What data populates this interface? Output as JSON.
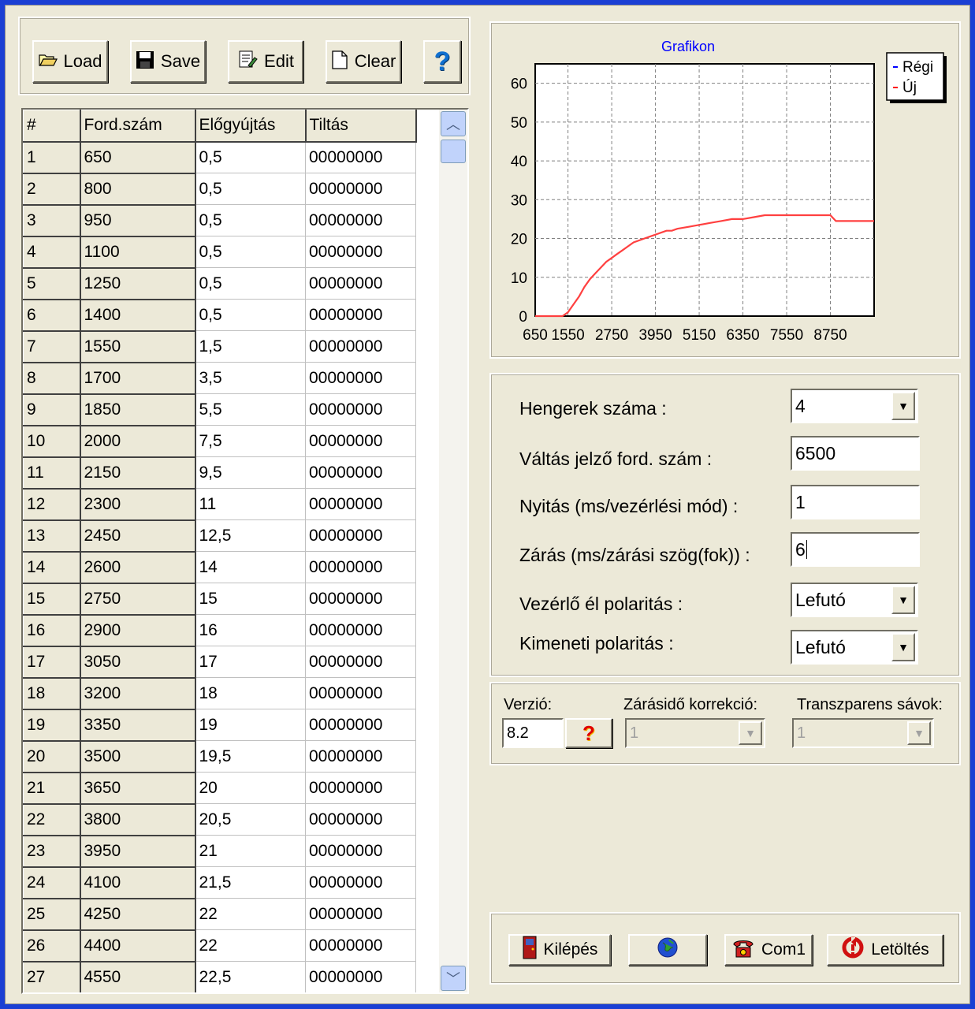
{
  "toolbar": {
    "load": "Load",
    "save": "Save",
    "edit": "Edit",
    "clear": "Clear",
    "help": "?"
  },
  "grid": {
    "headers": [
      "#",
      "Ford.szám",
      "Előgyújtás",
      "Tiltás"
    ],
    "rows": [
      [
        "1",
        "650",
        "0,5",
        "00000000"
      ],
      [
        "2",
        "800",
        "0,5",
        "00000000"
      ],
      [
        "3",
        "950",
        "0,5",
        "00000000"
      ],
      [
        "4",
        "1100",
        "0,5",
        "00000000"
      ],
      [
        "5",
        "1250",
        "0,5",
        "00000000"
      ],
      [
        "6",
        "1400",
        "0,5",
        "00000000"
      ],
      [
        "7",
        "1550",
        "1,5",
        "00000000"
      ],
      [
        "8",
        "1700",
        "3,5",
        "00000000"
      ],
      [
        "9",
        "1850",
        "5,5",
        "00000000"
      ],
      [
        "10",
        "2000",
        "7,5",
        "00000000"
      ],
      [
        "11",
        "2150",
        "9,5",
        "00000000"
      ],
      [
        "12",
        "2300",
        "11",
        "00000000"
      ],
      [
        "13",
        "2450",
        "12,5",
        "00000000"
      ],
      [
        "14",
        "2600",
        "14",
        "00000000"
      ],
      [
        "15",
        "2750",
        "15",
        "00000000"
      ],
      [
        "16",
        "2900",
        "16",
        "00000000"
      ],
      [
        "17",
        "3050",
        "17",
        "00000000"
      ],
      [
        "18",
        "3200",
        "18",
        "00000000"
      ],
      [
        "19",
        "3350",
        "19",
        "00000000"
      ],
      [
        "20",
        "3500",
        "19,5",
        "00000000"
      ],
      [
        "21",
        "3650",
        "20",
        "00000000"
      ],
      [
        "22",
        "3800",
        "20,5",
        "00000000"
      ],
      [
        "23",
        "3950",
        "21",
        "00000000"
      ],
      [
        "24",
        "4100",
        "21,5",
        "00000000"
      ],
      [
        "25",
        "4250",
        "22",
        "00000000"
      ],
      [
        "26",
        "4400",
        "22",
        "00000000"
      ],
      [
        "27",
        "4550",
        "22,5",
        "00000000"
      ]
    ]
  },
  "chart_data": {
    "type": "line",
    "title": "Grafikon",
    "x_tick_labels": [
      "650",
      "1550",
      "2750",
      "3950",
      "5150",
      "6350",
      "7550",
      "8750"
    ],
    "y_tick_labels": [
      "0",
      "10",
      "20",
      "30",
      "40",
      "50",
      "60"
    ],
    "ylim": [
      0,
      65
    ],
    "xlim": [
      650,
      9950
    ],
    "grid": true,
    "legend_position": "top-right",
    "legend": [
      {
        "label": "Régi",
        "color": "#0000ff"
      },
      {
        "label": "Új",
        "color": "#ff0000"
      }
    ],
    "series": [
      {
        "name": "Új",
        "color": "#ff4040",
        "points": [
          [
            650,
            0
          ],
          [
            1400,
            0
          ],
          [
            1550,
            1
          ],
          [
            1700,
            3
          ],
          [
            1850,
            5
          ],
          [
            2000,
            7.5
          ],
          [
            2150,
            9.5
          ],
          [
            2300,
            11
          ],
          [
            2450,
            12.5
          ],
          [
            2600,
            14
          ],
          [
            2750,
            15
          ],
          [
            2900,
            16
          ],
          [
            3050,
            17
          ],
          [
            3200,
            18
          ],
          [
            3350,
            19
          ],
          [
            3500,
            19.5
          ],
          [
            3650,
            20
          ],
          [
            3800,
            20.5
          ],
          [
            3950,
            21
          ],
          [
            4100,
            21.5
          ],
          [
            4250,
            22
          ],
          [
            4400,
            22
          ],
          [
            4550,
            22.5
          ],
          [
            4850,
            23
          ],
          [
            5150,
            23.5
          ],
          [
            5450,
            24
          ],
          [
            5750,
            24.5
          ],
          [
            6050,
            25
          ],
          [
            6350,
            25
          ],
          [
            6650,
            25.5
          ],
          [
            6950,
            26
          ],
          [
            7250,
            26
          ],
          [
            7550,
            26
          ],
          [
            7850,
            26
          ],
          [
            8150,
            26
          ],
          [
            8750,
            26
          ],
          [
            8900,
            24.5
          ],
          [
            9950,
            24.5
          ]
        ]
      }
    ]
  },
  "settings": {
    "cylinders_label": "Hengerek száma :",
    "cylinders_value": "4",
    "shift_rpm_label": "Váltás jelző ford. szám :",
    "shift_rpm_value": "6500",
    "opening_label": "Nyitás (ms/vezérlési mód) :",
    "opening_value": "1",
    "closing_label": "Zárás (ms/zárási szög(fok)) :",
    "closing_value": "6",
    "control_edge_label": "Vezérlő él polaritás :",
    "control_edge_value": "Lefutó",
    "output_polarity_label": "Kimeneti polaritás :",
    "output_polarity_value": "Lefutó"
  },
  "version": {
    "version_label": "Verzió:",
    "version_value": "8.2",
    "help_label": "?",
    "closing_correction_label": "Zárásidő korrekció:",
    "closing_correction_value": "1",
    "transparent_bands_label": "Transzparens sávok:",
    "transparent_bands_value": "1"
  },
  "bottom": {
    "exit": "Kilépés",
    "com": "Com1",
    "download": "Letöltés"
  }
}
